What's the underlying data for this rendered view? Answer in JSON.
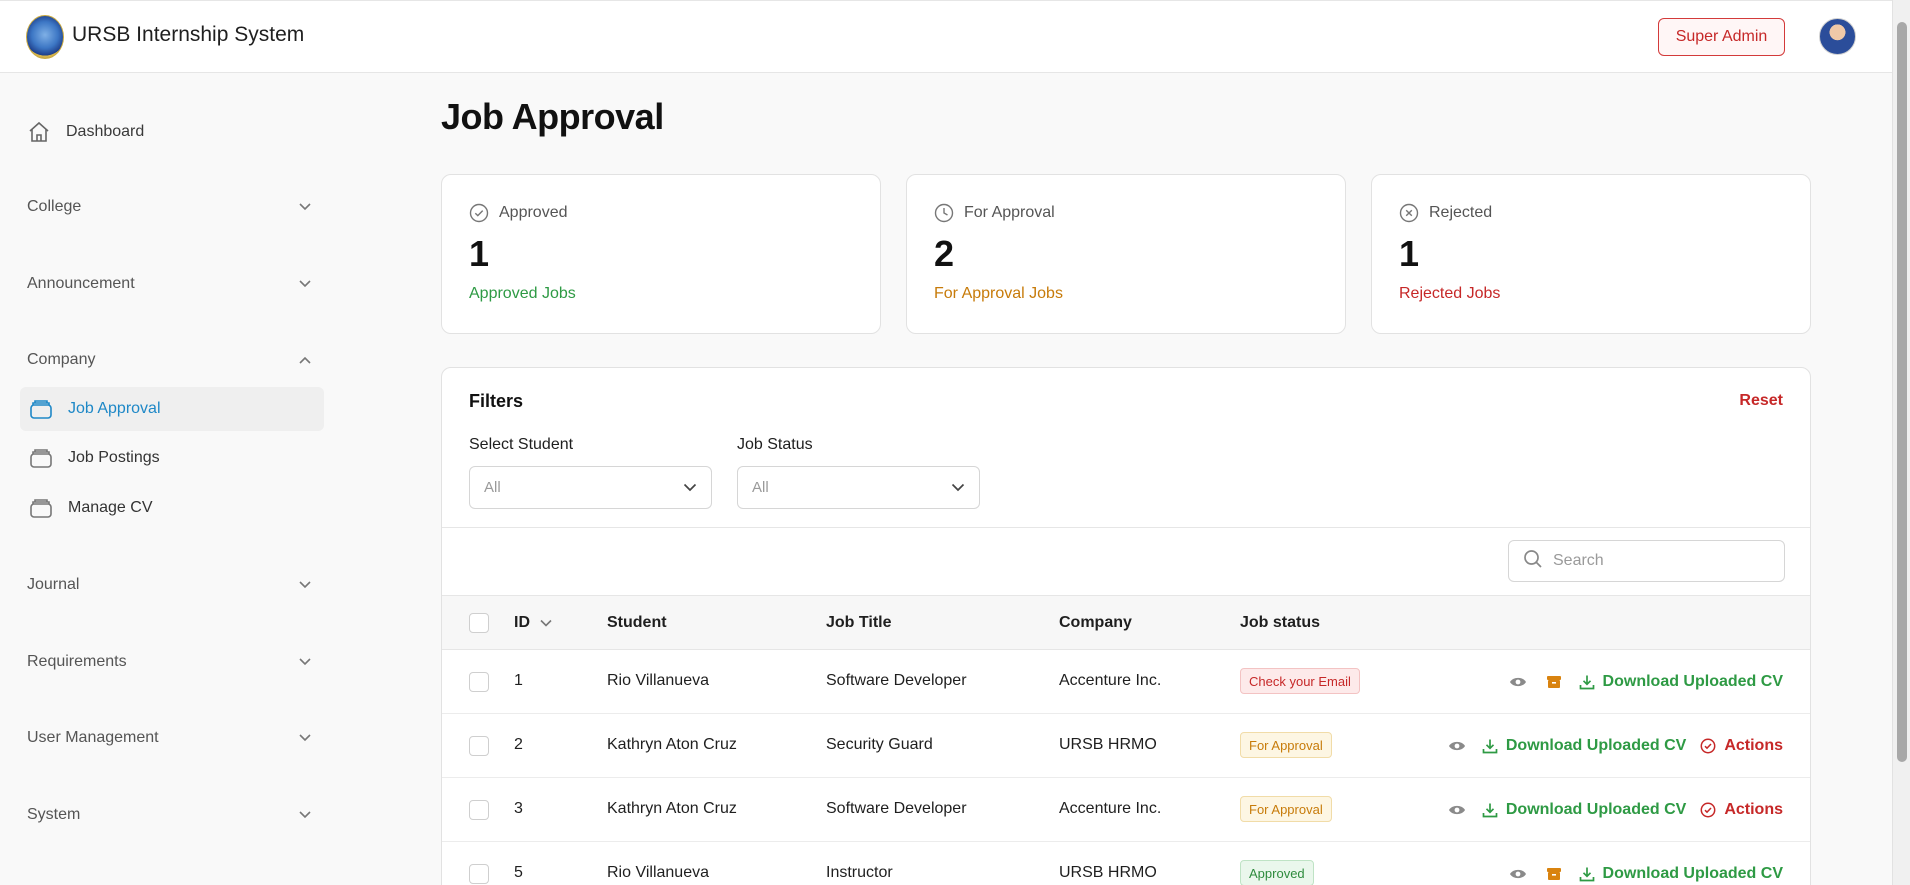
{
  "app": {
    "title": "URSB Internship System",
    "role_button": "Super Admin"
  },
  "sidebar": {
    "dashboard": "Dashboard",
    "groups": [
      "College",
      "Announcement",
      "Company",
      "Journal",
      "Requirements",
      "User Management",
      "System"
    ],
    "company_items": [
      "Job Approval",
      "Job Postings",
      "Manage CV"
    ]
  },
  "page": {
    "title": "Job Approval"
  },
  "stats": [
    {
      "label": "Approved",
      "value": "1",
      "sub": "Approved Jobs",
      "color": "#2e9a44"
    },
    {
      "label": "For Approval",
      "value": "2",
      "sub": "For Approval Jobs",
      "color": "#c77b0a"
    },
    {
      "label": "Rejected",
      "value": "1",
      "sub": "Rejected Jobs",
      "color": "#c62828"
    }
  ],
  "filters": {
    "title": "Filters",
    "reset": "Reset",
    "student_label": "Select Student",
    "student_value": "All",
    "status_label": "Job Status",
    "status_value": "All",
    "search_placeholder": "Search"
  },
  "table": {
    "columns": [
      "ID",
      "Student",
      "Job Title",
      "Company",
      "Job status"
    ],
    "download_label": "Download Uploaded CV",
    "actions_label": "Actions",
    "rows": [
      {
        "id": "1",
        "student": "Rio Villanueva",
        "job": "Software Developer",
        "company": "Accenture Inc.",
        "status": "Check your Email"
      },
      {
        "id": "2",
        "student": "Kathryn Aton Cruz",
        "job": "Security Guard",
        "company": "URSB HRMO",
        "status": "For Approval"
      },
      {
        "id": "3",
        "student": "Kathryn Aton Cruz",
        "job": "Software Developer",
        "company": "Accenture Inc.",
        "status": "For Approval"
      },
      {
        "id": "5",
        "student": "Rio Villanueva",
        "job": "Instructor",
        "company": "URSB HRMO",
        "status": "Approved"
      }
    ]
  },
  "colors": {
    "accent": "#1e88c7",
    "danger": "#c62828",
    "success": "#2e9a44",
    "warning": "#c77b0a"
  }
}
